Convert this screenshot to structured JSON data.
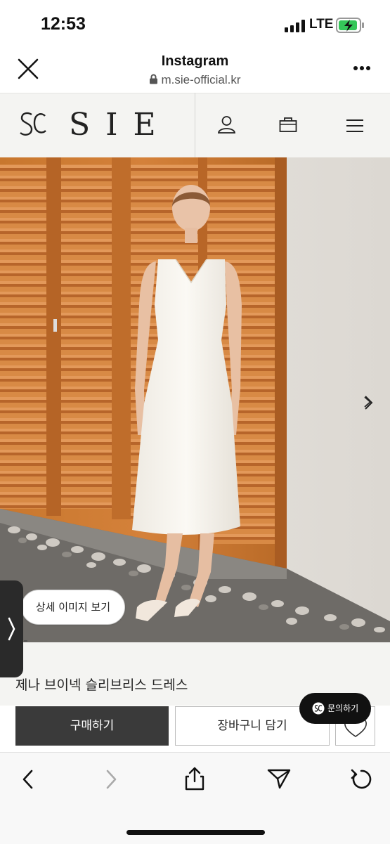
{
  "status_bar": {
    "time": "12:53",
    "network": "LTE"
  },
  "browser": {
    "title": "Instagram",
    "url": "m.sie-official.kr"
  },
  "site": {
    "brand": "SIE"
  },
  "product": {
    "detail_button": "상세 이미지 보기",
    "name": "제나 브이넥 슬리브리스 드레스",
    "buy_label": "구매하기",
    "cart_label": "장바구니 담기",
    "inquiry_label": "문의하기"
  }
}
